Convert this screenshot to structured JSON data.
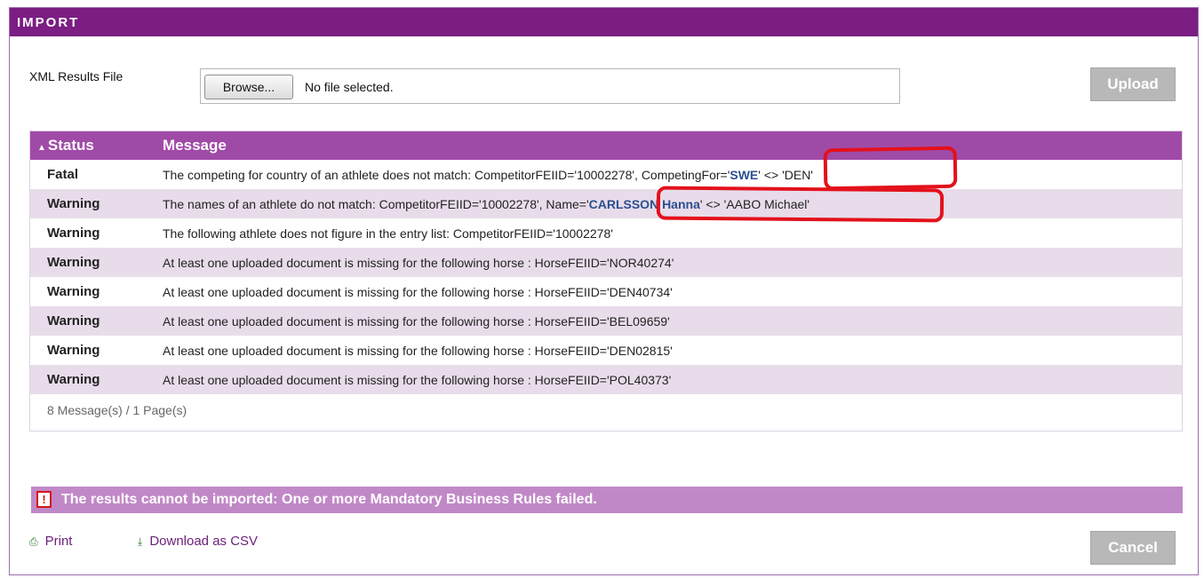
{
  "window": {
    "title": "IMPORT"
  },
  "upload_form": {
    "label": "XML Results File",
    "browse_label": "Browse...",
    "file_status": "No file selected.",
    "upload_label": "Upload"
  },
  "grid": {
    "columns": {
      "status": "Status",
      "message": "Message"
    },
    "rows": [
      {
        "status": "Fatal",
        "msg_before": "The competing for country of an athlete does not match: CompetitorFEIID='10002278', CompetingFor='",
        "msg_highlight": "SWE",
        "msg_after": "' <> 'DEN'"
      },
      {
        "status": "Warning",
        "msg_before": "The names of an athlete do not match: CompetitorFEIID='10002278', Name='",
        "msg_highlight": "CARLSSON Hanna",
        "msg_after": "' <> 'AABO Michael'"
      },
      {
        "status": "Warning",
        "message": "The following athlete does not figure in the entry list: CompetitorFEIID='10002278'"
      },
      {
        "status": "Warning",
        "message": "At least one uploaded document is missing for the following horse : HorseFEIID='NOR40274'"
      },
      {
        "status": "Warning",
        "message": "At least one uploaded document is missing for the following horse : HorseFEIID='DEN40734'"
      },
      {
        "status": "Warning",
        "message": "At least one uploaded document is missing for the following horse : HorseFEIID='BEL09659'"
      },
      {
        "status": "Warning",
        "message": "At least one uploaded document is missing for the following horse : HorseFEIID='DEN02815'"
      },
      {
        "status": "Warning",
        "message": "At least one uploaded document is missing for the following horse : HorseFEIID='POL40373'"
      }
    ],
    "footer": "8 Message(s) / 1 Page(s)"
  },
  "error": {
    "icon": "!",
    "text": "The results cannot be imported: One or more Mandatory Business Rules failed."
  },
  "actions": {
    "print_label": "Print",
    "csv_label": "Download as CSV",
    "cancel_label": "Cancel"
  },
  "colors": {
    "titlebar": "#7b1d82",
    "header": "#a04aa8",
    "alt_row": "#e8dcea",
    "error_bar": "#c188c7",
    "highlight_text": "#2c4f8e",
    "annotation": "#e3111b"
  }
}
